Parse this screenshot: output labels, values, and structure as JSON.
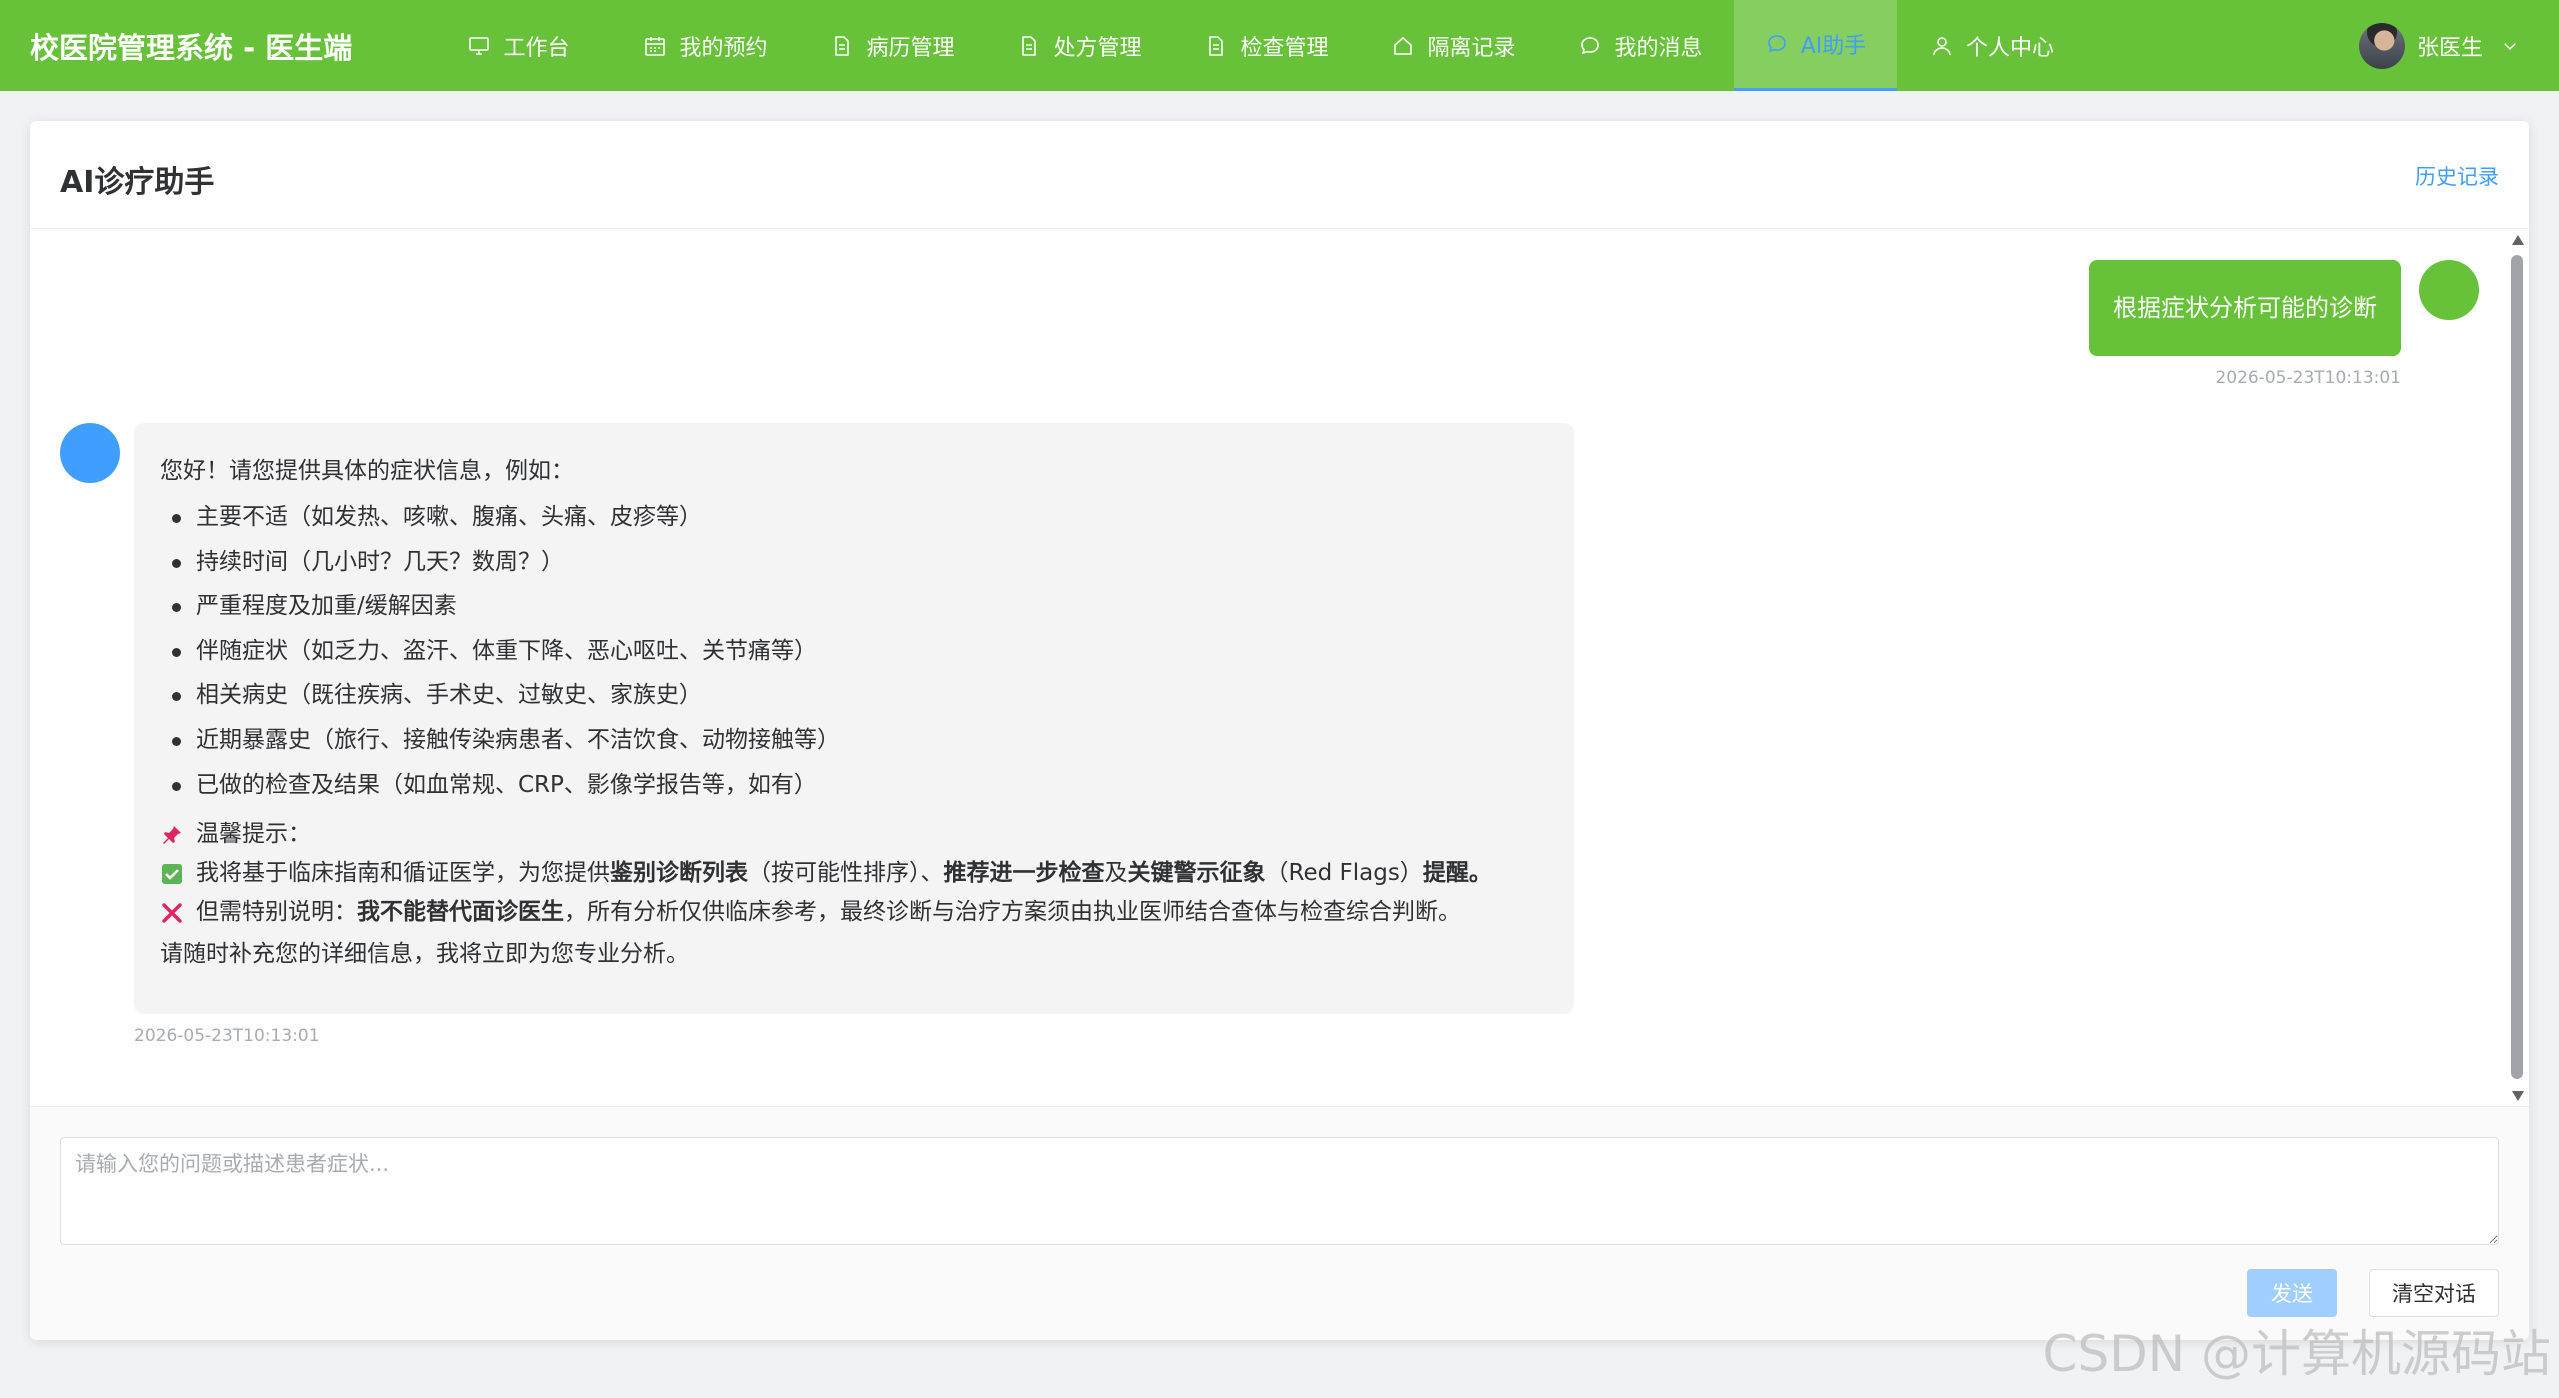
{
  "app": {
    "title": "校医院管理系统 - 医生端"
  },
  "nav": {
    "items": [
      {
        "label": "工作台",
        "icon": "monitor-icon"
      },
      {
        "label": "我的预约",
        "icon": "calendar-icon"
      },
      {
        "label": "病历管理",
        "icon": "document-icon"
      },
      {
        "label": "处方管理",
        "icon": "document-icon"
      },
      {
        "label": "检查管理",
        "icon": "document-icon"
      },
      {
        "label": "隔离记录",
        "icon": "house-icon"
      },
      {
        "label": "我的消息",
        "icon": "chat-icon"
      },
      {
        "label": "AI助手",
        "icon": "chat-icon",
        "active": true
      },
      {
        "label": "个人中心",
        "icon": "user-icon"
      }
    ]
  },
  "user": {
    "name": "张医生"
  },
  "colors": {
    "primary_green": "#67c23a",
    "accent_blue": "#409eff",
    "ai_avatar": "#409eff"
  },
  "page": {
    "title": "AI诊疗助手",
    "history_label": "历史记录"
  },
  "chat": {
    "user_message": {
      "text": "根据症状分析可能的诊断",
      "time": "2026-05-23T10:13:01"
    },
    "ai_message": {
      "intro": "您好！请您提供具体的症状信息，例如：",
      "bullets": [
        "主要不适（如发热、咳嗽、腹痛、头痛、皮疹等）",
        "持续时间（几小时？几天？数周？）",
        "严重程度及加重/缓解因素",
        "伴随症状（如乏力、盗汗、体重下降、恶心呕吐、关节痛等）",
        "相关病史（既往疾病、手术史、过敏史、家族史）",
        "近期暴露史（旅行、接触传染病患者、不洁饮食、动物接触等）",
        "已做的检查及结果（如血常规、CRP、影像学报告等，如有）"
      ],
      "tip_title": "温馨提示：",
      "tip1": {
        "prefix": "我将基于临床指南和循证医学，为您提供",
        "b1": "鉴别诊断列表",
        "mid1": "（按可能性排序）、",
        "b2": "推荐进一步检查",
        "mid2": "及",
        "b3": "关键警示征象",
        "mid3": "（Red Flags）",
        "b4": "提醒。"
      },
      "tip2": {
        "prefix": "但需特别说明：",
        "bold": "我不能替代面诊医生",
        "suffix": "，所有分析仅供临床参考，最终诊断与治疗方案须由执业医师结合查体与检查综合判断。"
      },
      "closing": "请随时补充您的详细信息，我将立即为您专业分析。",
      "time": "2026-05-23T10:13:01"
    }
  },
  "input": {
    "placeholder": "请输入您的问题或描述患者症状..."
  },
  "buttons": {
    "send": "发送",
    "clear": "清空对话"
  },
  "watermark": "CSDN @计算机源码站"
}
